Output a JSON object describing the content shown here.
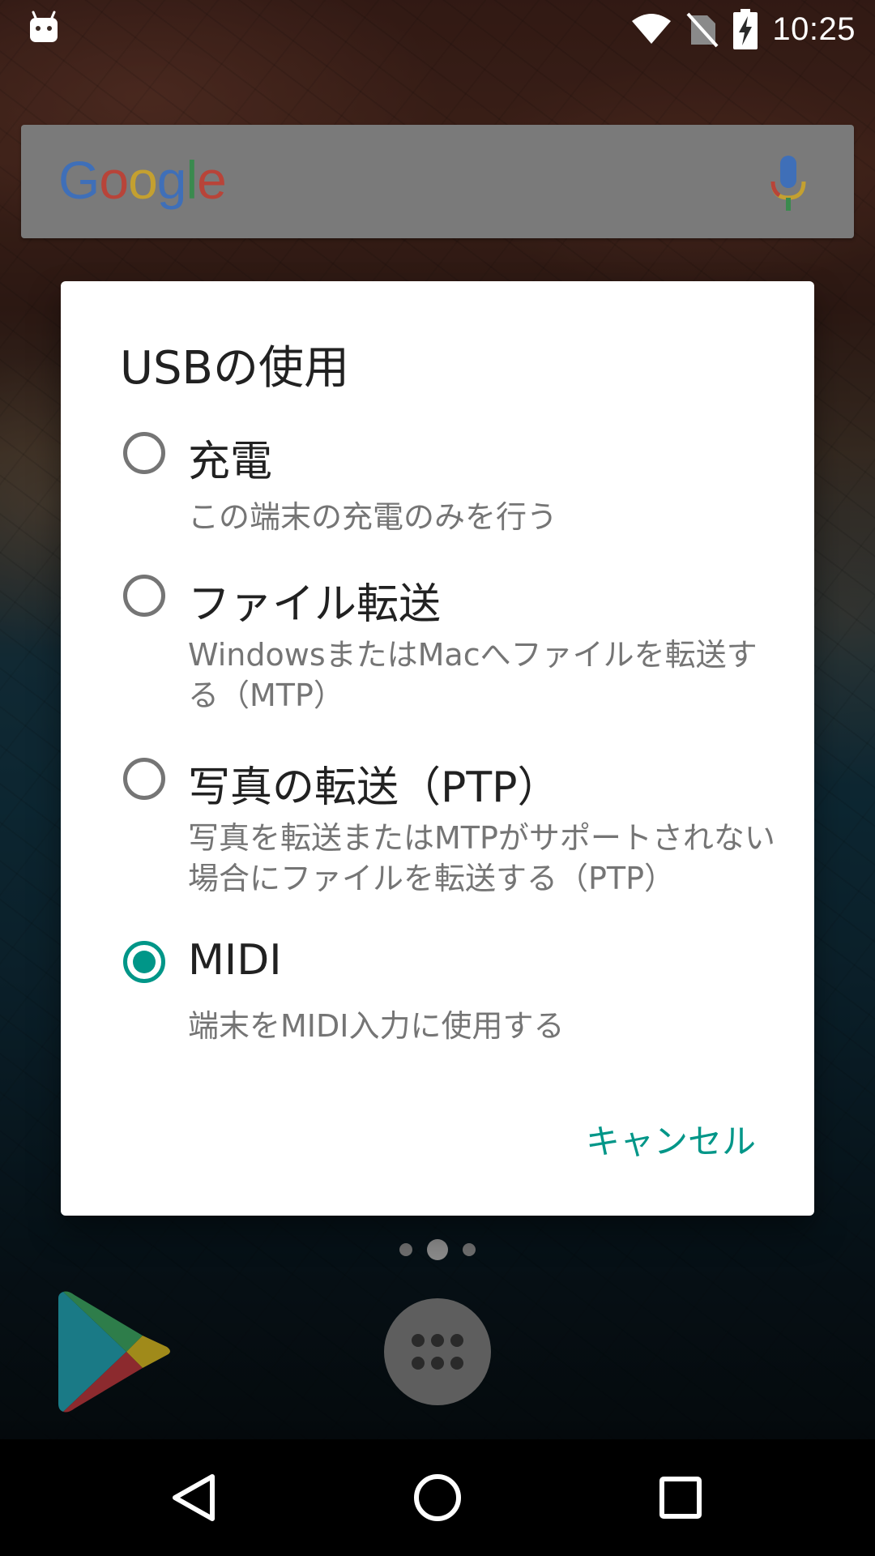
{
  "status_bar": {
    "time": "10:25",
    "icons": [
      "android-debug-icon",
      "wifi-icon",
      "no-sim-icon",
      "battery-charging-icon"
    ]
  },
  "search_bar": {
    "logo_text": [
      "G",
      "o",
      "o",
      "g",
      "l",
      "e"
    ],
    "logo_colors": [
      "#4285f4",
      "#ea4335",
      "#fbbc05",
      "#4285f4",
      "#34a853",
      "#ea4335"
    ],
    "mic_icon": "mic-icon"
  },
  "dialog": {
    "title": "USBの使用",
    "options": [
      {
        "label": "充電",
        "description": "この端末の充電のみを行う",
        "selected": false
      },
      {
        "label": "ファイル転送",
        "description": "WindowsまたはMacへファイルを転送する（MTP）",
        "selected": false
      },
      {
        "label": "写真の転送（PTP）",
        "description": "写真を転送またはMTPがサポートされない場合にファイルを転送する（PTP）",
        "selected": false
      },
      {
        "label": "MIDI",
        "description": "端末をMIDI入力に使用する",
        "selected": true
      }
    ],
    "cancel_label": "キャンセル",
    "accent_color": "#009688"
  },
  "home": {
    "dock_icons": [
      "play-store-icon",
      "app-drawer-icon"
    ],
    "page_count": 3,
    "current_page": 2
  },
  "nav_bar": {
    "buttons": [
      "back-icon",
      "home-icon",
      "recents-icon"
    ]
  }
}
